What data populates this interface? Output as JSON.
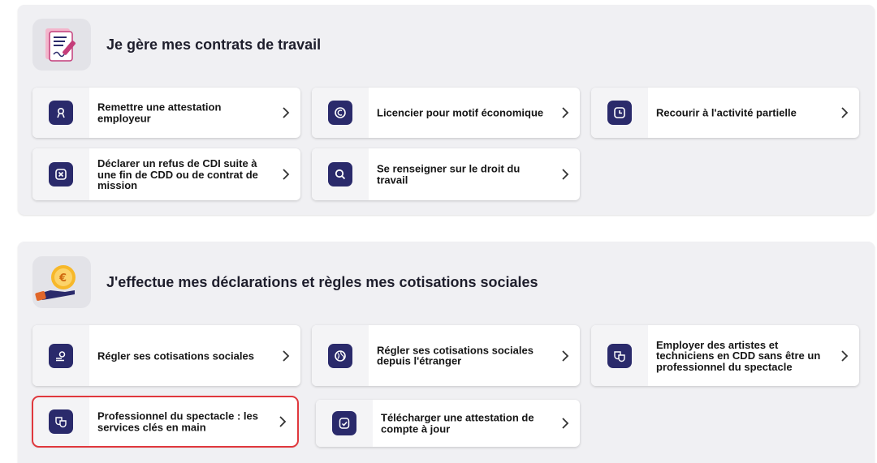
{
  "sections": [
    {
      "title": "Je gère mes contrats de travail",
      "icon": "contract-document-icon",
      "cards": [
        {
          "label": "Remettre une attestation employeur",
          "icon": "attestation-icon"
        },
        {
          "label": "Licencier pour motif économique",
          "icon": "euro-coin-icon"
        },
        {
          "label": "Recourir à l'activité partielle",
          "icon": "clock-icon"
        },
        {
          "label": "Déclarer un refus de CDI suite à une fin de CDD ou de contrat de mission",
          "icon": "refuse-cross-icon"
        },
        {
          "label": "Se renseigner sur le droit du travail",
          "icon": "search-icon"
        }
      ]
    },
    {
      "title": "J'effectue mes déclarations et règles mes cotisations sociales",
      "icon": "hand-euro-coin-icon",
      "cards": [
        {
          "label": "Régler ses cotisations sociales",
          "icon": "coins-payment-icon"
        },
        {
          "label": "Régler ses cotisations sociales depuis l'étranger",
          "icon": "globe-icon"
        },
        {
          "label": "Employer des artistes et techniciens en CDD sans être un professionnel du spectacle",
          "icon": "theater-masks-icon"
        },
        {
          "label": "Professionnel du spectacle : les services clés en main",
          "icon": "theater-masks-icon"
        },
        {
          "label": "Télécharger une attestation de compte à jour",
          "icon": "download-certificate-icon"
        }
      ]
    }
  ],
  "colors": {
    "section_bg": "#f0f0f3",
    "icon_bg": "#2a2a6b",
    "highlight": "#e0383d",
    "text": "#161616"
  }
}
